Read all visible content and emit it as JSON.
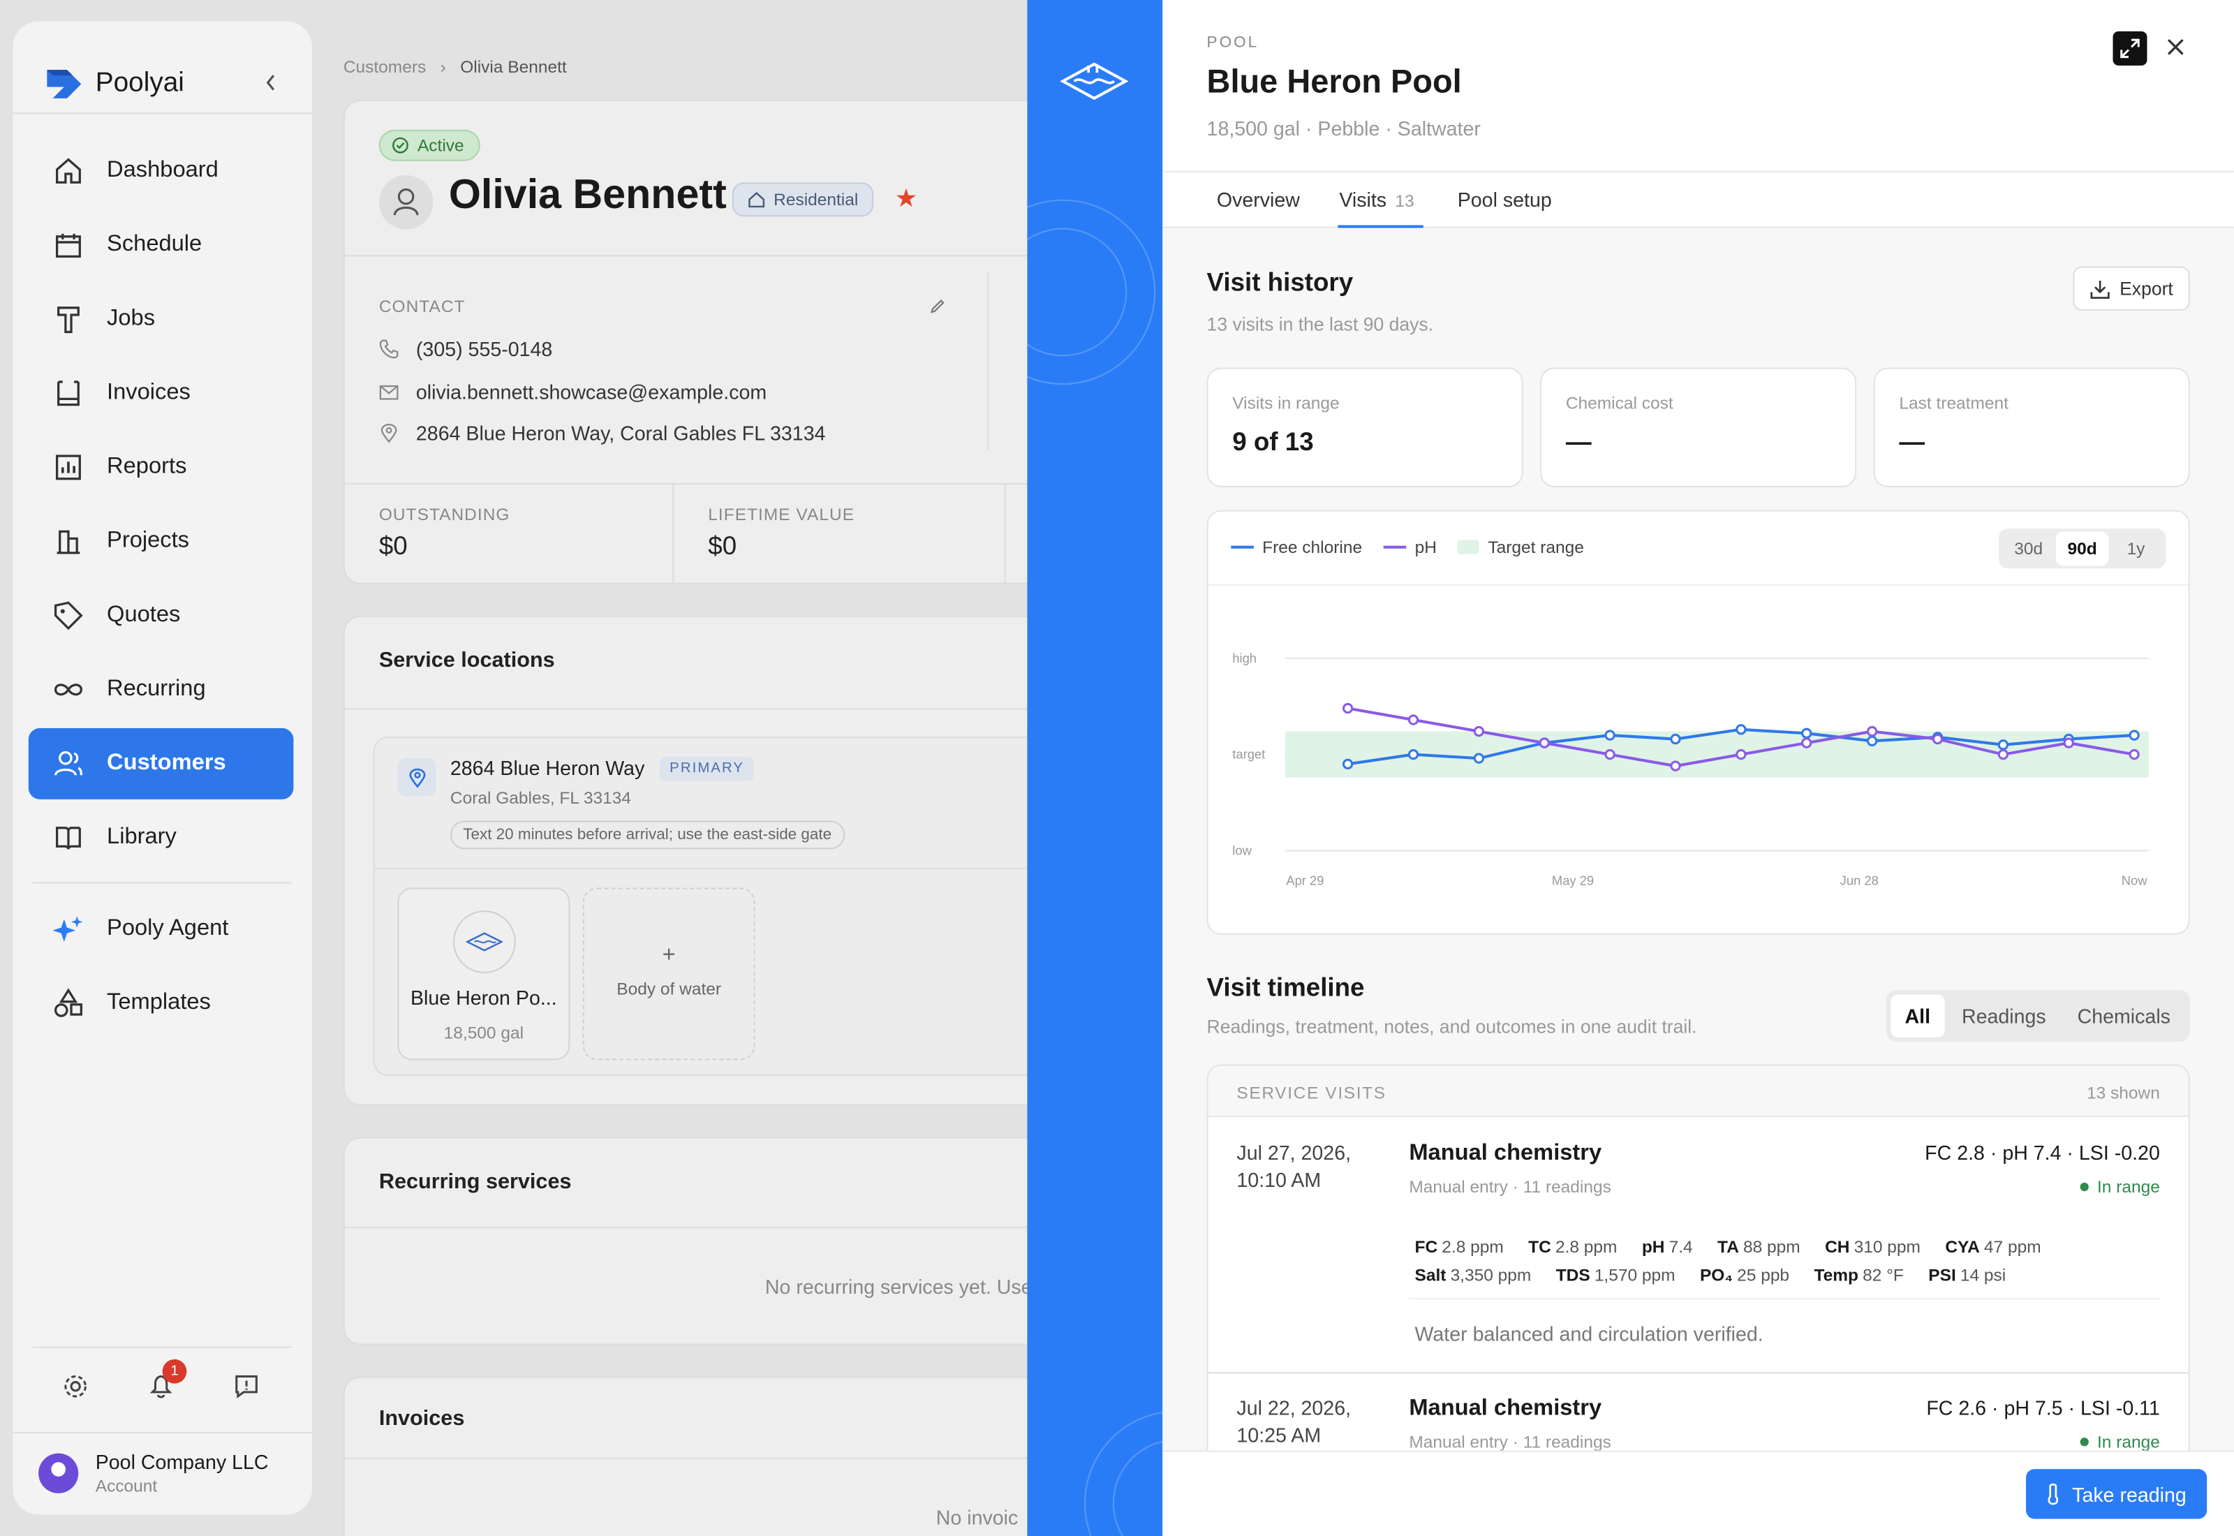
{
  "app": {
    "name": "Poolyai"
  },
  "sidebar": {
    "items": [
      {
        "label": "Dashboard",
        "icon": "home-icon"
      },
      {
        "label": "Schedule",
        "icon": "calendar-icon"
      },
      {
        "label": "Jobs",
        "icon": "hammer-icon"
      },
      {
        "label": "Invoices",
        "icon": "receipt-icon"
      },
      {
        "label": "Reports",
        "icon": "bar-chart-icon"
      },
      {
        "label": "Projects",
        "icon": "building-icon"
      },
      {
        "label": "Quotes",
        "icon": "tag-icon"
      },
      {
        "label": "Recurring",
        "icon": "infinity-icon"
      },
      {
        "label": "Customers",
        "icon": "users-icon",
        "active": true
      },
      {
        "label": "Library",
        "icon": "book-icon"
      }
    ],
    "extra_items": [
      {
        "label": "Pooly Agent",
        "icon": "sparkles-icon"
      },
      {
        "label": "Templates",
        "icon": "shapes-icon"
      }
    ],
    "notification_count": "1",
    "account": {
      "name": "Pool Company LLC",
      "sub": "Account"
    }
  },
  "breadcrumb": {
    "parent": "Customers",
    "current": "Olivia Bennett"
  },
  "customer": {
    "status": "Active",
    "name": "Olivia Bennett",
    "type": "Residential",
    "contact_label": "CONTACT",
    "phone": "(305) 555-0148",
    "email": "olivia.bennett.showcase@example.com",
    "address": "2864 Blue Heron Way, Coral Gables FL 33134",
    "outstanding_label": "OUTSTANDING",
    "outstanding": "$0",
    "lifetime_label": "LIFETIME VALUE",
    "lifetime": "$0"
  },
  "service_locations": {
    "title": "Service locations",
    "street": "2864 Blue Heron Way",
    "badge": "PRIMARY",
    "city": "Coral Gables, FL 33134",
    "note": "Text 20 minutes before arrival; use the east-side gate",
    "pool_name": "Blue Heron Po...",
    "pool_size": "18,500 gal",
    "add_label": "Body of water"
  },
  "recurring": {
    "title": "Recurring services",
    "empty": "No recurring services yet. Use"
  },
  "invoices": {
    "title": "Invoices",
    "empty": "No invoic"
  },
  "panel": {
    "eyebrow": "POOL",
    "title": "Blue Heron Pool",
    "subtitle": "18,500 gal · Pebble · Saltwater",
    "tabs": [
      {
        "label": "Overview",
        "count": ""
      },
      {
        "label": "Visits",
        "count": "13"
      },
      {
        "label": "Pool setup",
        "count": ""
      }
    ],
    "history_title": "Visit history",
    "history_sub": "13 visits in the last 90 days.",
    "export_label": "Export",
    "kpis": [
      {
        "label": "Visits in range",
        "value": "9 of 13"
      },
      {
        "label": "Chemical cost",
        "value": "—"
      },
      {
        "label": "Last treatment",
        "value": "—"
      }
    ],
    "range_options": [
      "30d",
      "90d",
      "1y"
    ],
    "range_selected": "90d",
    "timeline_title": "Visit timeline",
    "timeline_sub": "Readings, treatment, notes, and outcomes in one audit trail.",
    "filters": [
      "All",
      "Readings",
      "Chemicals"
    ],
    "list_label": "SERVICE VISITS",
    "list_count": "13 shown",
    "visits": [
      {
        "date1": "Jul 27, 2026,",
        "date2": "10:10 AM",
        "title": "Manual chemistry",
        "meta": "Manual entry · 11 readings",
        "summary": "FC 2.8 · pH 7.4 · LSI -0.20",
        "status": "In range",
        "readings_row1": [
          {
            "k": "FC",
            "v": "2.8 ppm"
          },
          {
            "k": "TC",
            "v": "2.8 ppm"
          },
          {
            "k": "pH",
            "v": "7.4"
          },
          {
            "k": "TA",
            "v": "88 ppm"
          },
          {
            "k": "CH",
            "v": "310 ppm"
          },
          {
            "k": "CYA",
            "v": "47 ppm"
          }
        ],
        "readings_row2": [
          {
            "k": "Salt",
            "v": "3,350 ppm"
          },
          {
            "k": "TDS",
            "v": "1,570 ppm"
          },
          {
            "k": "PO₄",
            "v": "25 ppb"
          },
          {
            "k": "Temp",
            "v": "82 °F"
          },
          {
            "k": "PSI",
            "v": "14 psi"
          }
        ],
        "note": "Water balanced and circulation verified."
      },
      {
        "date1": "Jul 22, 2026,",
        "date2": "10:25 AM",
        "title": "Manual chemistry",
        "meta": "Manual entry · 11 readings",
        "summary": "FC 2.6 · pH 7.5 · LSI -0.11",
        "status": "In range"
      }
    ],
    "take_reading_label": "Take reading"
  },
  "colors": {
    "accent": "#2a7cf6",
    "free_chlorine": "#2f78e8",
    "ph": "#8a5ae6",
    "target_fill": "#dff3e6",
    "in_range": "#2e8b4d"
  },
  "chart_data": {
    "type": "line",
    "x": [
      "Apr 29",
      "",
      "",
      "",
      "May 29",
      "",
      "",
      "",
      "Jun 28",
      "",
      "",
      "",
      "",
      "Now"
    ],
    "x_tick_labels": [
      "Apr 29",
      "May 29",
      "Jun 28",
      "Now"
    ],
    "y_tick_labels": [
      "high",
      "target",
      "low"
    ],
    "ylim": [
      0,
      1
    ],
    "target_range": [
      0.38,
      0.62
    ],
    "series": [
      {
        "name": "Free chlorine",
        "values": [
          0.45,
          0.5,
          0.48,
          0.56,
          0.6,
          0.58,
          0.63,
          0.61,
          0.57,
          0.59,
          0.55,
          0.58,
          0.6
        ]
      },
      {
        "name": "pH",
        "values": [
          0.74,
          0.68,
          0.62,
          0.56,
          0.5,
          0.44,
          0.5,
          0.56,
          0.62,
          0.58,
          0.5,
          0.56,
          0.5
        ]
      }
    ],
    "legend": [
      "Free chlorine",
      "pH",
      "Target range"
    ],
    "grid": true,
    "legend_position": "top-left"
  }
}
